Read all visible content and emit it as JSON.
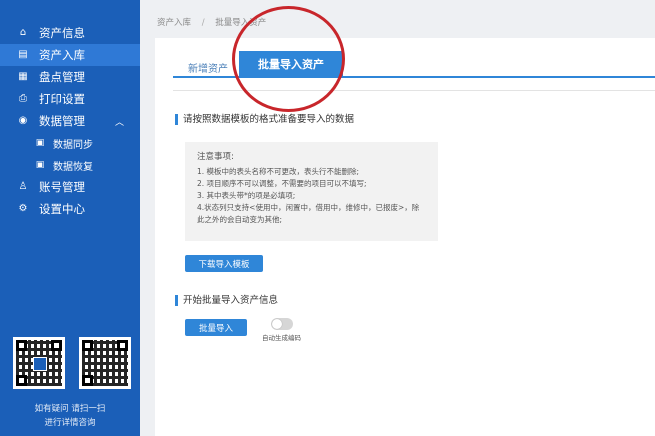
{
  "sidebar": {
    "items": [
      {
        "label": "资产信息",
        "icon": "home-icon",
        "glyph": "⌂"
      },
      {
        "label": "资产入库",
        "icon": "document-icon",
        "glyph": "▤",
        "active": true
      },
      {
        "label": "盘点管理",
        "icon": "clipboard-icon",
        "glyph": "▦"
      },
      {
        "label": "打印设置",
        "icon": "printer-icon",
        "glyph": "⎙"
      },
      {
        "label": "数据管理",
        "icon": "database-icon",
        "glyph": "◉",
        "expanded": true
      },
      {
        "label": "数据同步",
        "icon": "sync-icon",
        "glyph": "▣",
        "sub": true
      },
      {
        "label": "数据恢复",
        "icon": "restore-icon",
        "glyph": "▣",
        "sub": true
      },
      {
        "label": "账号管理",
        "icon": "user-icon",
        "glyph": "♙"
      },
      {
        "label": "设置中心",
        "icon": "gear-icon",
        "glyph": "⚙"
      }
    ],
    "help_line1": "如有疑问 请扫一扫",
    "help_line2": "进行详情咨询"
  },
  "breadcrumb": {
    "parent": "资产入库",
    "separator": "/",
    "current": "批量导入资产"
  },
  "tabs": {
    "new_asset": "新增资产",
    "batch_import": "批量导入资产"
  },
  "section1": {
    "title": "请按照数据模板的格式准备要导入的数据"
  },
  "notes": {
    "title": "注意事项:",
    "lines": [
      "1. 模板中的表头名称不可更改，表头行不能删除;",
      "2. 项目顺序不可以调整，不需要的项目可以不填写;",
      "3. 其中表头带*的项是必填项;",
      "4.状态列只支持<使用中，闲置中，借用中，维修中，已报废>，除",
      "此之外的会自动变为其他;"
    ]
  },
  "download_button": "下载导入模板",
  "section2": {
    "title": "开始批量导入资产信息"
  },
  "import_button": "批量导入",
  "auto_code_toggle": {
    "label": "自动生成编码",
    "on": false
  },
  "colors": {
    "sidebar": "#1b5fb8",
    "active_item": "#2f79d6",
    "accent": "#2f86d8",
    "annotation_circle": "#c8262b"
  }
}
